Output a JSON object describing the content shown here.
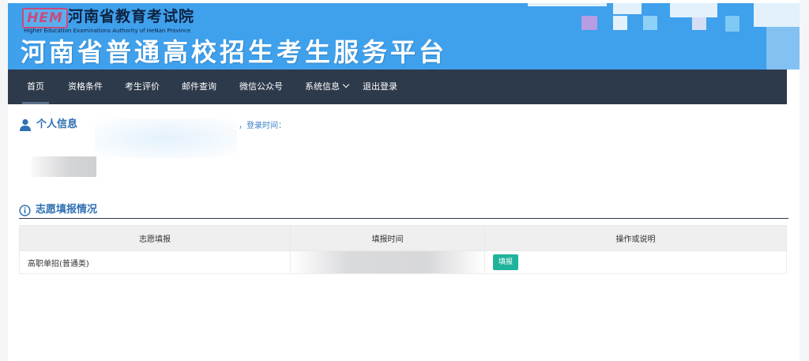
{
  "header": {
    "logo_text": "HEM",
    "org_name": "河南省教育考试院",
    "org_english": "Higher Education Examinations Authority of HeNan Province",
    "platform_title": "河南省普通高校招生考生服务平台"
  },
  "nav": {
    "items": [
      {
        "label": "首页",
        "active": true
      },
      {
        "label": "资格条件"
      },
      {
        "label": "考生评价"
      },
      {
        "label": "邮件查询"
      },
      {
        "label": "微信公众号"
      },
      {
        "label": "系统信息"
      },
      {
        "label": "退出登录"
      }
    ]
  },
  "personal": {
    "title": "个人信息",
    "login_time_label": "，登录时间："
  },
  "application": {
    "title": "志愿填报情况",
    "columns": [
      "志愿填报",
      "填报时间",
      "操作或说明"
    ],
    "rows": [
      {
        "category": "高职单招(普通类)",
        "time": "",
        "action_label": "填报"
      }
    ]
  },
  "colors": {
    "banner": "#3fa0ec",
    "nav_bg": "#2d3a4b",
    "accent_text": "#2f6fb3",
    "button": "#20b39c"
  },
  "icons": {
    "personal_icon": "user-icon",
    "application_icon": "info-circle-icon",
    "dropdown_icon": "chevron-down-icon"
  }
}
